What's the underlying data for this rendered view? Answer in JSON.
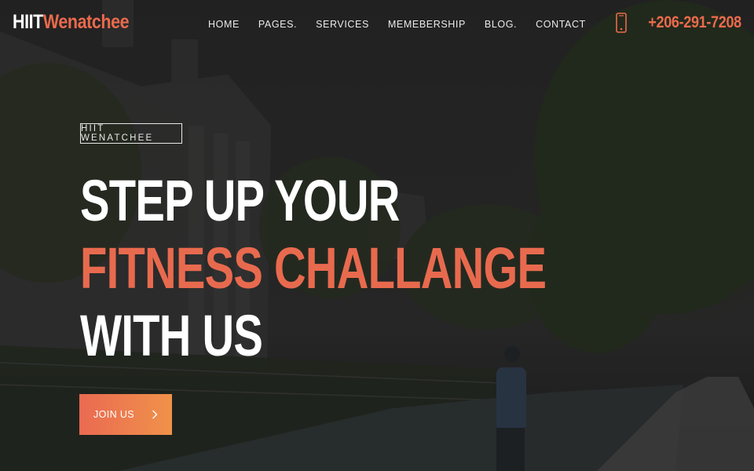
{
  "brand": {
    "part1": "HIIT",
    "part2": "Wenatchee"
  },
  "nav": {
    "items": [
      {
        "label": "HOME"
      },
      {
        "label": "PAGES."
      },
      {
        "label": "SERVICES"
      },
      {
        "label": "MEMEBERSHIP"
      },
      {
        "label": "BLOG."
      },
      {
        "label": "CONTACT"
      }
    ]
  },
  "phone": {
    "number": "+206-291-7208",
    "icon": "mobile-phone-icon"
  },
  "hero": {
    "badge": "HIIT WENATCHEE",
    "line1": "STEP UP YOUR",
    "line2": "FITNESS CHALLANGE",
    "line3": "WITH US",
    "cta_label": "JOIN US",
    "cta_icon": "chevron-right-icon"
  },
  "colors": {
    "accent": "#ea6a4c",
    "cta_start": "#ea6a52",
    "cta_end": "#f0924a",
    "text_light": "#ffffff"
  }
}
